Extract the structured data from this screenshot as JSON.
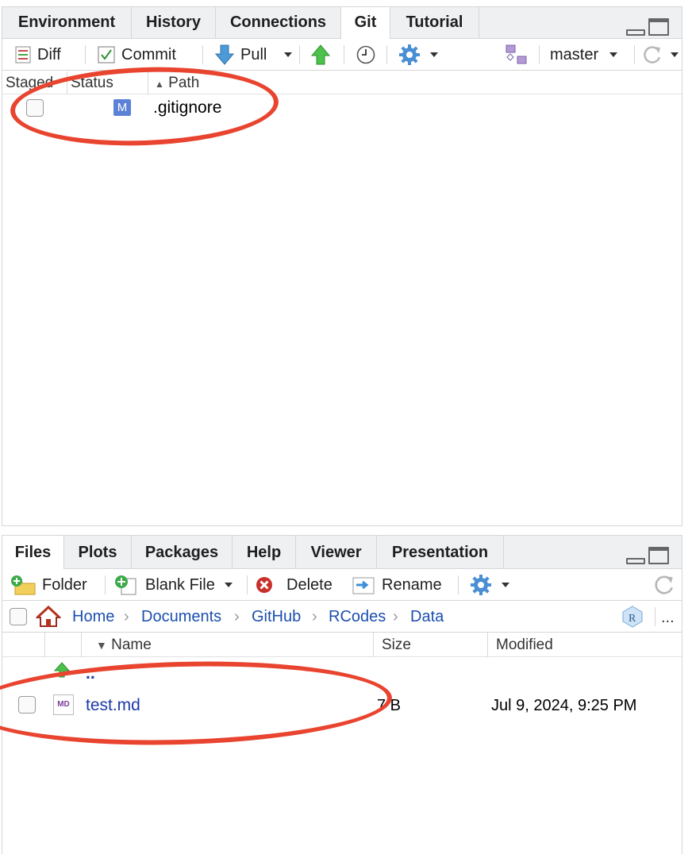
{
  "git_pane": {
    "tabs": [
      {
        "label": "Environment",
        "active": false
      },
      {
        "label": "History",
        "active": false
      },
      {
        "label": "Connections",
        "active": false
      },
      {
        "label": "Git",
        "active": true
      },
      {
        "label": "Tutorial",
        "active": false
      }
    ],
    "toolbar": {
      "diff_label": "Diff",
      "commit_label": "Commit",
      "pull_label": "Pull",
      "branch_label": "master"
    },
    "columns": {
      "staged": "Staged",
      "status": "Status",
      "path": "Path"
    },
    "files": [
      {
        "staged": false,
        "status": "M",
        "path": ".gitignore"
      }
    ]
  },
  "files_pane": {
    "tabs": [
      {
        "label": "Files",
        "active": true
      },
      {
        "label": "Plots",
        "active": false
      },
      {
        "label": "Packages",
        "active": false
      },
      {
        "label": "Help",
        "active": false
      },
      {
        "label": "Viewer",
        "active": false
      },
      {
        "label": "Presentation",
        "active": false
      }
    ],
    "toolbar": {
      "folder_label": "Folder",
      "blank_file_label": "Blank File",
      "delete_label": "Delete",
      "rename_label": "Rename"
    },
    "breadcrumb": [
      "Home",
      "Documents",
      "GitHub",
      "RCodes",
      "Data"
    ],
    "more_label": "...",
    "columns": {
      "name": "Name",
      "size": "Size",
      "modified": "Modified"
    },
    "parent_label": "..",
    "rows": [
      {
        "icon": "MD",
        "name": "test.md",
        "size": "7 B",
        "modified": "Jul 9, 2024, 9:25 PM"
      }
    ]
  },
  "colors": {
    "annotation": "#e8442f",
    "link": "#1c4fae",
    "status_modified": "#5b82d6"
  }
}
